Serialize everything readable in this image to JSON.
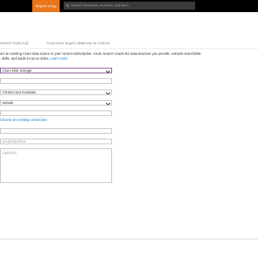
{
  "topbar": {
    "report_bug": "Report a bug",
    "search_placeholder": "Search resources, services, and docs"
  },
  "tabs": [
    {
      "label": "Search (Optional)"
    },
    {
      "label": "Customize target index"
    },
    {
      "label": "Create an indexer"
    }
  ],
  "description": {
    "text": "om an existing Azure data source in your current subscription. Azure Search crawls the data structure you provide, extracts searchable",
    "text2": ", skills, and loads it into an index.",
    "link": "Learn more"
  },
  "form": {
    "data_source": "Azure Blob Storage",
    "name_value": "",
    "parsing_mode": "Content and metadata",
    "parsing_mode2": "Default",
    "connection_value": "",
    "choose_connection_link": "Choose an existing connection",
    "container_value": "",
    "folder_placeholder": "your/folder/here",
    "description_placeholder": "(optional)"
  },
  "colors": {
    "accent": "#0078d4",
    "report_bug_bg": "#e8761b",
    "topbar_bg": "#000000"
  }
}
